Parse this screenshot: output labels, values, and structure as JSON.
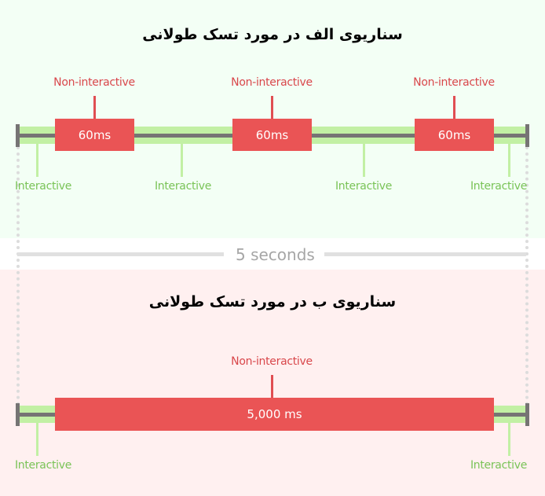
{
  "scenario_a": {
    "title": "سناریوی الف در مورد تسک طولانی",
    "tasks": [
      {
        "label": "60ms",
        "annotation": "Non-interactive"
      },
      {
        "label": "60ms",
        "annotation": "Non-interactive"
      },
      {
        "label": "60ms",
        "annotation": "Non-interactive"
      }
    ],
    "interactive_labels": [
      "Interactive",
      "Interactive",
      "Interactive",
      "Interactive"
    ]
  },
  "divider": {
    "label": "5 seconds"
  },
  "scenario_b": {
    "title": "سناریوی ب در مورد تسک طولانی",
    "task": {
      "label": "5,000 ms",
      "annotation": "Non-interactive"
    },
    "interactive_labels": [
      "Interactive",
      "Interactive"
    ]
  },
  "colors": {
    "non_interactive": "#ea5455",
    "interactive": "#c2f0a4",
    "interactive_text": "#79c357",
    "non_interactive_text": "#d9474b",
    "timeline": "#767474",
    "panel_a_bg": "#f3fff5",
    "panel_b_bg": "#fff0f0"
  }
}
